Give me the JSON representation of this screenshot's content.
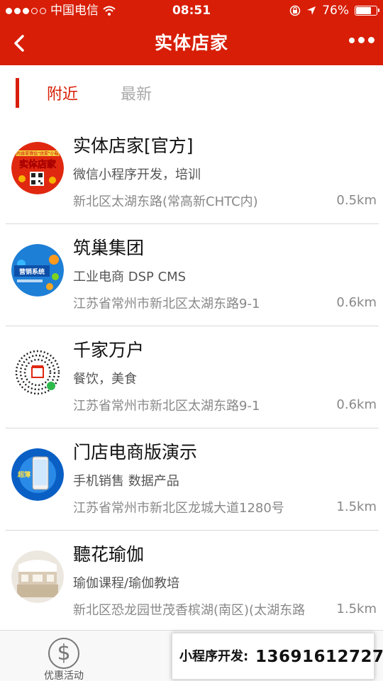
{
  "status": {
    "carrier": "中国电信",
    "time": "08:51",
    "battery": "76%",
    "battery_level": 0.76
  },
  "nav": {
    "title": "实体店家"
  },
  "tabs": [
    {
      "label": "附近",
      "active": true
    },
    {
      "label": "最新",
      "active": false
    }
  ],
  "stores": [
    {
      "name": "实体店家[官方]",
      "desc": "微信小程序开发，培训",
      "addr": "新北区太湖东路(常高新CHTC内)",
      "dist": "0.5km",
      "avatar_text": "实体店家",
      "avatar_banner": "国内首家微信\"店家\"小程序"
    },
    {
      "name": "筑巢集团",
      "desc": "工业电商 DSP CMS",
      "addr": "江苏省常州市新北区太湖东路9-1",
      "dist": "0.6km",
      "avatar_text": "营销系统"
    },
    {
      "name": "千家万户",
      "desc": "餐饮，美食",
      "addr": "江苏省常州市新北区太湖东路9-1",
      "dist": "0.6km",
      "avatar_text": ""
    },
    {
      "name": "门店电商版演示",
      "desc": "手机销售 数据产品",
      "addr": "江苏省常州市新北区龙城大道1280号",
      "dist": "1.5km",
      "avatar_text": "超薄"
    },
    {
      "name": "聽花瑜伽",
      "desc": "瑜伽课程/瑜伽教培",
      "addr": "新北区恐龙园世茂香槟湖(南区)(太湖东路",
      "dist": "1.5km",
      "avatar_text": ""
    }
  ],
  "tabbar": {
    "item_label": "优惠活动"
  },
  "promo": {
    "label": "小程序开发:",
    "phone": "13691612727"
  },
  "colors": {
    "brand_red": "#d81e06"
  },
  "icons": {
    "back": "chevron-left-icon",
    "more": "more-dots-icon",
    "coupon": "dollar-circle-icon"
  }
}
